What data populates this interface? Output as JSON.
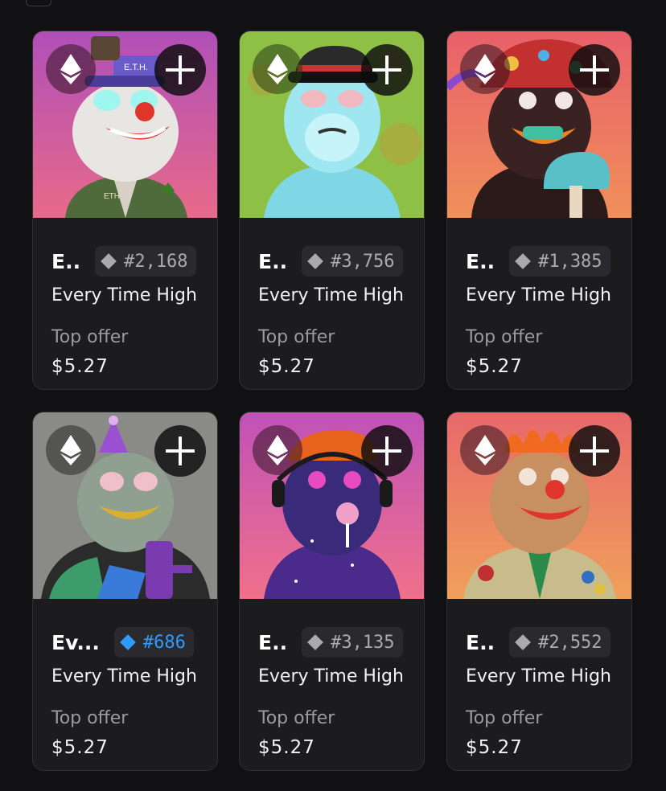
{
  "cards": [
    {
      "short_name": "E..",
      "token": "#2,168",
      "rare": false,
      "collection": "Every Time High",
      "offer_label": "Top offer",
      "offer_value": "$5.27",
      "hat_text": "E.T.H.",
      "jacket_text": "ETH"
    },
    {
      "short_name": "E..",
      "token": "#3,756",
      "rare": false,
      "collection": "Every Time High",
      "offer_label": "Top offer",
      "offer_value": "$5.27"
    },
    {
      "short_name": "E..",
      "token": "#1,385",
      "rare": false,
      "collection": "Every Time High",
      "offer_label": "Top offer",
      "offer_value": "$5.27"
    },
    {
      "short_name": "Ev...",
      "token": "#686",
      "rare": true,
      "collection": "Every Time High",
      "offer_label": "Top offer",
      "offer_value": "$5.27"
    },
    {
      "short_name": "E..",
      "token": "#3,135",
      "rare": false,
      "collection": "Every Time High",
      "offer_label": "Top offer",
      "offer_value": "$5.27"
    },
    {
      "short_name": "E..",
      "token": "#2,552",
      "rare": false,
      "collection": "Every Time High",
      "offer_label": "Top offer",
      "offer_value": "$5.27"
    }
  ],
  "icons": {
    "chain": "ethereum-icon",
    "add": "plus-icon",
    "rarity": "diamond-icon"
  },
  "colors": {
    "background": "#111113",
    "card": "#1c1c1f",
    "rare_accent": "#2f9bff",
    "muted_text": "#9a9aa0"
  }
}
